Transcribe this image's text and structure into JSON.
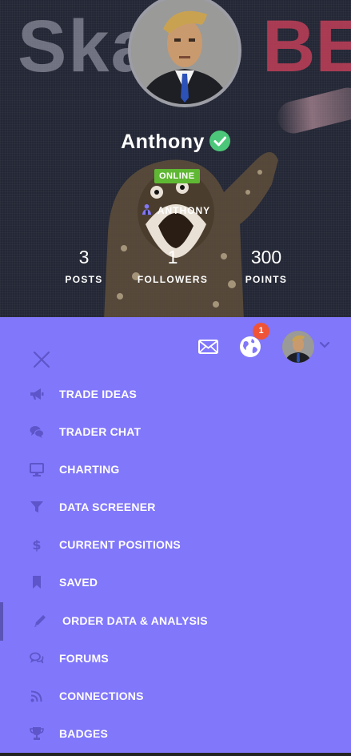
{
  "cover": {
    "text_main": "Skary",
    "text_accent": "BE"
  },
  "profile": {
    "name": "Anthony",
    "verified": true,
    "status": "ONLINE",
    "username": "ANTHONY",
    "stats": [
      {
        "value": "3",
        "label": "POSTS"
      },
      {
        "value": "1",
        "label": "FOLLOWERS"
      },
      {
        "value": "300",
        "label": "POINTS"
      }
    ]
  },
  "topbar": {
    "notification_count": "1"
  },
  "menu": {
    "items": [
      {
        "label": "TRADE IDEAS",
        "icon": "megaphone-icon"
      },
      {
        "label": "TRADER CHAT",
        "icon": "chat-bubbles-icon"
      },
      {
        "label": "CHARTING",
        "icon": "monitor-icon"
      },
      {
        "label": "DATA SCREENER",
        "icon": "filter-icon"
      },
      {
        "label": "CURRENT POSITIONS",
        "icon": "dollar-icon"
      },
      {
        "label": "SAVED",
        "icon": "bookmark-icon"
      },
      {
        "label": "ORDER DATA & ANALYSIS",
        "icon": "pencil-icon"
      },
      {
        "label": "FORUMS",
        "icon": "comments-icon"
      },
      {
        "label": "CONNECTIONS",
        "icon": "rss-icon"
      },
      {
        "label": "BADGES",
        "icon": "trophy-icon"
      }
    ]
  },
  "colors": {
    "panel_bg": "#8177fa",
    "icon_muted": "#5d55c9",
    "online": "#5fb833",
    "verified": "#4cc77a",
    "notification": "#ef5436",
    "accent_cover": "#c03f58"
  }
}
